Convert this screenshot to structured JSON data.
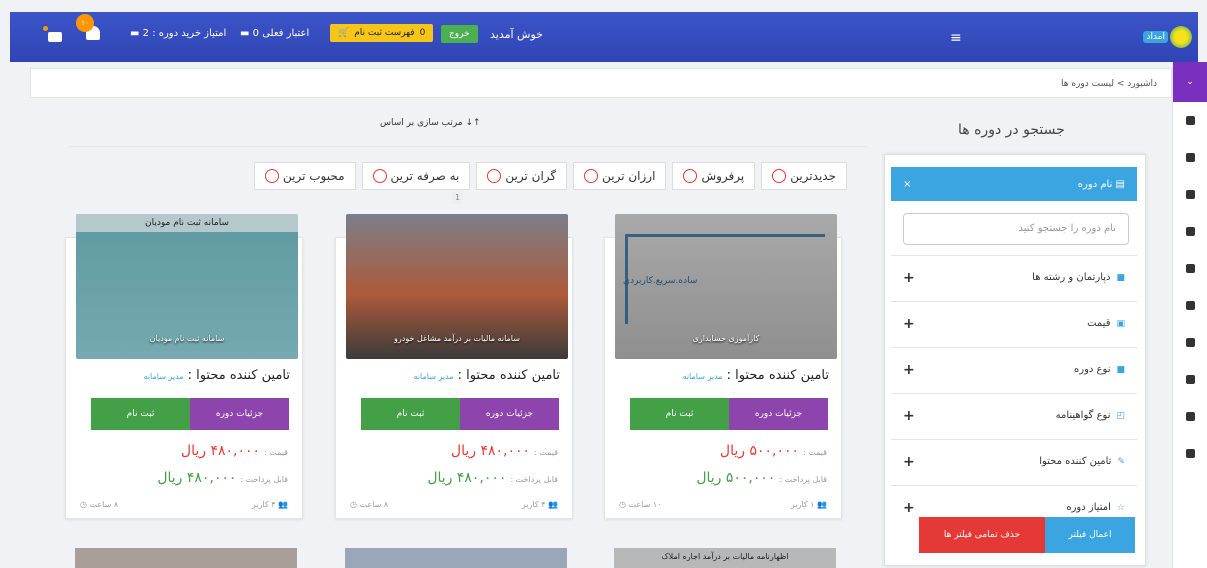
{
  "topbar": {
    "logo_text": "امداد",
    "welcome": "خوش آمدید",
    "exit_label": "خروج",
    "cart_label": "فهرست ثبت نام",
    "cart_count": "0",
    "current_credit": "اعتبار فعلی  0",
    "buy_credit": "امتیاز خرید دوره : 2",
    "notification_count": "۱۰"
  },
  "breadcrumb": "داشبورد > لیست دوره ها",
  "sort": {
    "title": "مرتب سازی بر اساس",
    "options": [
      "جدیدترین",
      "پرفروش",
      "ارزان ترین",
      "گران ترین",
      "به صرفه ترین",
      "محبوب ترین"
    ],
    "page": "1"
  },
  "search": {
    "title": "جستجو در دوره ها",
    "head_label": "نام دوره",
    "close": "×",
    "placeholder": "نام دوره را جستجو کنید",
    "filters": [
      "دپارتمان و رشته ها",
      "قیمت",
      "نوع دوره",
      "نوع گواهینامه",
      "تامین کننده محتوا",
      "امتیاز دوره"
    ],
    "apply": "اعمال فیلتر",
    "clear": "حذف تمامی فیلتر ها"
  },
  "cards": [
    {
      "image_caption": "کارآموزی حسابداری",
      "image_tag": "ساده.سریع.کاربردی",
      "provider_label": "تامین کننده محتوا :",
      "provider_name": "مدیر سامانه",
      "details": "جزئیات دوره",
      "register": "ثبت نام",
      "price_label": "قیمت :",
      "price": "۵۰۰,۰۰۰ ریال",
      "payable_label": "قابل پرداخت :",
      "payable": "۵۰۰,۰۰۰ ریال",
      "users": "۱ کاربر",
      "hours": "۱۰ ساعت"
    },
    {
      "image_caption": "سامانه مالیات بر درآمد مشاغل خودرو",
      "provider_label": "تامین کننده محتوا :",
      "provider_name": "مدیر سامانه",
      "details": "جزئیات دوره",
      "register": "ثبت نام",
      "price_label": "قیمت :",
      "price": "۴۸۰,۰۰۰ ریال",
      "payable_label": "قابل پرداخت :",
      "payable": "۴۸۰,۰۰۰ ریال",
      "users": "۴ کاربر",
      "hours": "۸ ساعت"
    },
    {
      "image_banner": "سامانه ثبت نام مودیان",
      "image_caption": "سامانه ثبت نام مودیان",
      "provider_label": "تامین کننده محتوا :",
      "provider_name": "مدیر سامانه",
      "details": "جزئیات دوره",
      "register": "ثبت نام",
      "price_label": "قیمت :",
      "price": "۴۸۰,۰۰۰ ریال",
      "payable_label": "قابل پرداخت :",
      "payable": "۴۸۰,۰۰۰ ریال",
      "users": "۴ کاربر",
      "hours": "۸ ساعت"
    }
  ],
  "next_row_card": "اظهارنامه مالیات بر درآمد اجاره املاک",
  "colors": {
    "primary": "#3b54c7",
    "accent": "#3aa5e0",
    "purple": "#8e44ad",
    "green": "#43a047",
    "red": "#e53935"
  }
}
